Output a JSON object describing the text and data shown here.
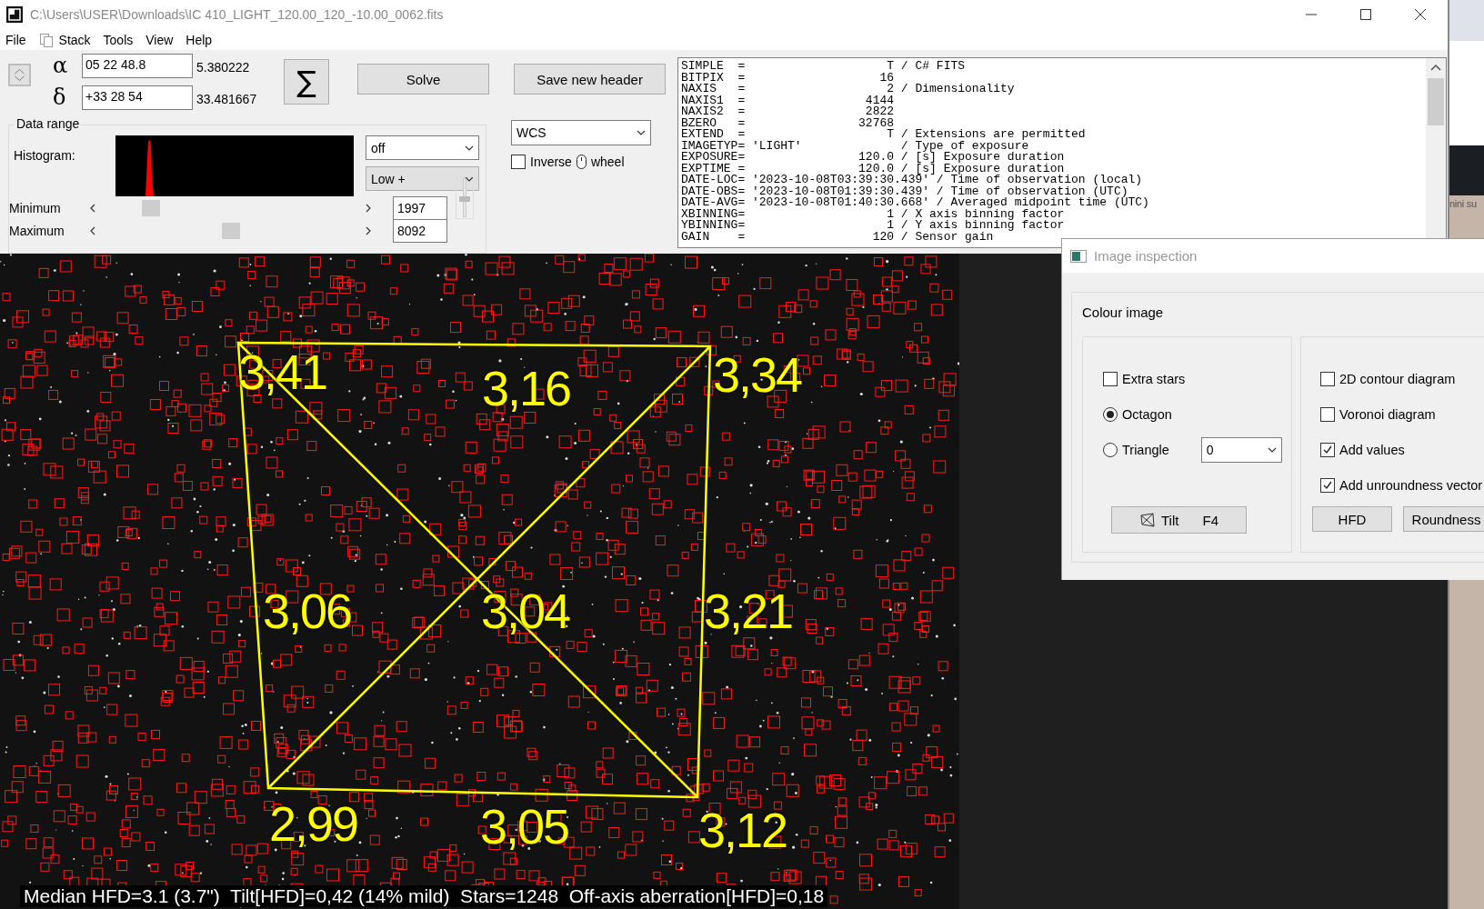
{
  "window": {
    "title": "C:\\Users\\USER\\Downloads\\IC 410_LIGHT_120.00_120_-10.00_0062.fits"
  },
  "menu": [
    {
      "label": "File",
      "has_icon": false
    },
    {
      "label": "Stack",
      "has_icon": true
    },
    {
      "label": "Tools",
      "has_icon": false
    },
    {
      "label": "View",
      "has_icon": false
    },
    {
      "label": "Help",
      "has_icon": false
    }
  ],
  "coordinates": [
    {
      "symbol": "α",
      "value": "05 22 48.8",
      "decimal": "5.380222"
    },
    {
      "symbol": "δ",
      "value": "+33 28 54",
      "decimal": "33.481667"
    }
  ],
  "sum_button": "∑",
  "buttons": [
    "Solve",
    "Save new header"
  ],
  "data_range": {
    "title": "Data range",
    "histogram_label": "Histogram:",
    "stretch": "off",
    "mode": "Low +",
    "sliders": [
      {
        "label": "Minimum",
        "value": "1997"
      },
      {
        "label": "Maximum",
        "value": "8092"
      }
    ],
    "vertical_slider": {
      "level": 0.5
    }
  },
  "projection": "WCS",
  "inverse_wheel": {
    "label": "Inverse",
    "suffix": "wheel",
    "checked": false
  },
  "header_lines": [
    "SIMPLE  =                    T / C# FITS",
    "BITPIX  =                   16",
    "NAXIS   =                    2 / Dimensionality",
    "NAXIS1  =                 4144",
    "NAXIS2  =                 2822",
    "BZERO   =                32768",
    "EXTEND  =                    T / Extensions are permitted",
    "IMAGETYP= 'LIGHT'              / Type of exposure",
    "EXPOSURE=                120.0 / [s] Exposure duration",
    "EXPTIME =                120.0 / [s] Exposure duration",
    "DATE-LOC= '2023-10-08T03:39:30.439' / Time of observation (local)",
    "DATE-OBS= '2023-10-08T01:39:30.439' / Time of observation (UTC)",
    "DATE-AVG= '2023-10-08T01:40:30.668' / Averaged midpoint time (UTC)",
    "XBINNING=                    1 / X axis binning factor",
    "YBINNING=                    1 / Y axis binning factor",
    "GAIN    =                  120 / Sensor gain"
  ],
  "image": {
    "tilt_values": [
      "3,41",
      "3,16",
      "3,34",
      "3,06",
      "3,04",
      "3,21",
      "2,99",
      "3,05",
      "3,12"
    ],
    "status": "Median HFD=3.1 (3.7\")  Tilt[HFD]=0,42 (14% mild)  Stars=1248  Off-axis aberration[HFD]=0,18"
  },
  "background_window": {
    "caption": "nini su"
  },
  "dialog": {
    "title": "Image inspection",
    "section": "Colour image",
    "left_options": [
      {
        "kind": "checkbox",
        "label": "Extra stars",
        "checked": false
      },
      {
        "kind": "radio",
        "label": "Octagon",
        "selected": true
      },
      {
        "kind": "radio",
        "label": "Triangle",
        "selected": false
      }
    ],
    "triangle_select": "0",
    "tilt_button": {
      "label": "Tilt",
      "shortcut": "F4"
    },
    "right_options": [
      {
        "kind": "checkbox",
        "label": "2D contour diagram",
        "checked": false
      },
      {
        "kind": "checkbox",
        "label": "Voronoi diagram",
        "checked": false
      },
      {
        "kind": "checkbox",
        "label": "Add values",
        "checked": true
      },
      {
        "kind": "checkbox",
        "label": "Add unroundness vector",
        "checked": true
      }
    ],
    "buttons": [
      "HFD",
      "Roundness"
    ]
  }
}
